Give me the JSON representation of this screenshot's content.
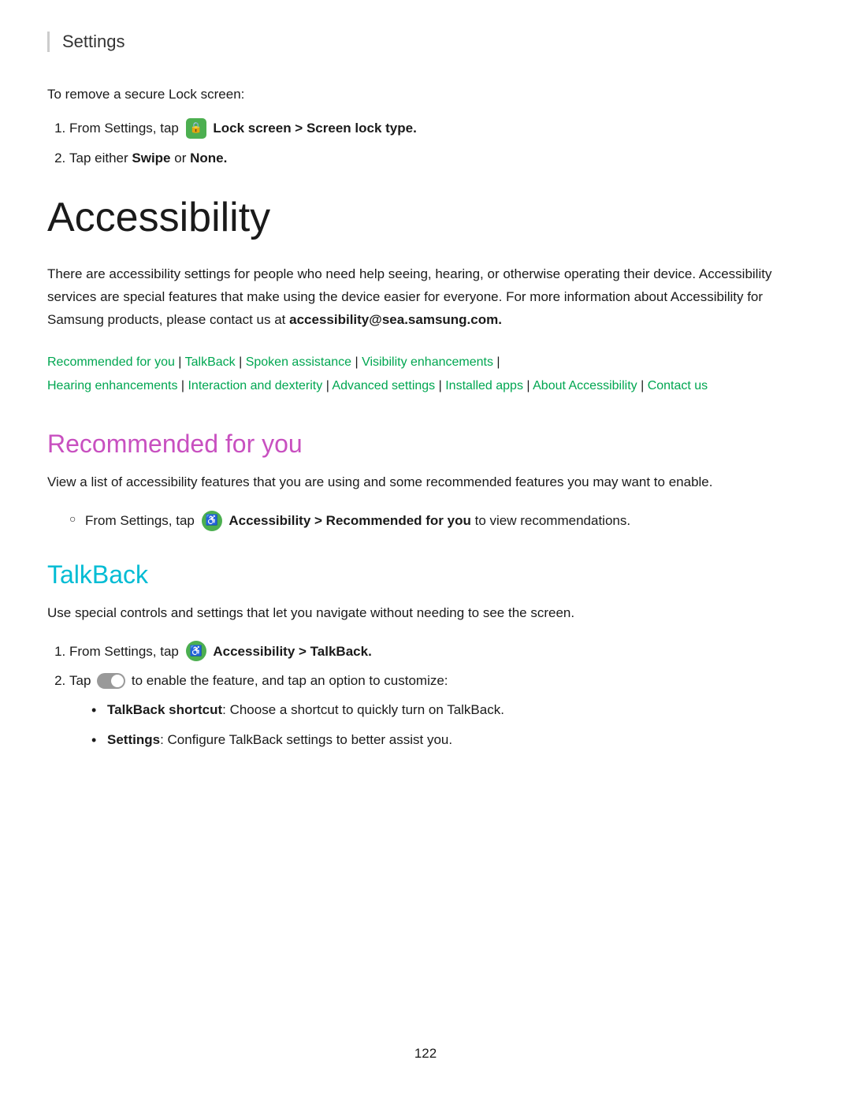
{
  "header": {
    "title": "Settings",
    "border_color": "#cccccc"
  },
  "intro": {
    "text": "To remove a secure Lock screen:",
    "steps": [
      {
        "id": 1,
        "prefix": "From Settings, tap",
        "icon": "lock-icon",
        "bold_text": "Lock screen > Screen lock type.",
        "suffix": ""
      },
      {
        "id": 2,
        "prefix": "Tap either",
        "bold_parts": [
          "Swipe",
          "None"
        ],
        "connector": "or",
        "suffix": "."
      }
    ]
  },
  "page_title": "Accessibility",
  "description": "There are accessibility settings for people who need help seeing, hearing, or otherwise operating their device. Accessibility services are special features that make using the device easier for everyone. For more information about Accessibility for Samsung products, please contact us at",
  "email": "accessibility@sea.samsung.com.",
  "nav_links": [
    {
      "label": "Recommended for you",
      "color": "#00a651"
    },
    {
      "label": "TalkBack",
      "color": "#00a651"
    },
    {
      "label": "Spoken assistance",
      "color": "#00a651"
    },
    {
      "label": "Visibility enhancements",
      "color": "#00a651"
    },
    {
      "label": "Hearing enhancements",
      "color": "#00a651"
    },
    {
      "label": "Interaction and dexterity",
      "color": "#00a651"
    },
    {
      "label": "Advanced settings",
      "color": "#00a651"
    },
    {
      "label": "Installed apps",
      "color": "#00a651"
    },
    {
      "label": "About Accessibility",
      "color": "#00a651"
    },
    {
      "label": "Contact us",
      "color": "#00a651"
    }
  ],
  "sections": [
    {
      "id": "recommended",
      "title": "Recommended for you",
      "title_color": "#c850c0",
      "description": "View a list of accessibility features that you are using and some recommended features you may want to enable.",
      "items": [
        {
          "type": "bullet",
          "prefix": "From Settings, tap",
          "icon": "accessibility-icon",
          "bold_text": "Accessibility > Recommended for you",
          "suffix": "to view recommendations."
        }
      ]
    },
    {
      "id": "talkback",
      "title": "TalkBack",
      "title_color": "#00bcd4",
      "description": "Use special controls and settings that let you navigate without needing to see the screen.",
      "numbered_items": [
        {
          "id": 1,
          "prefix": "From Settings, tap",
          "icon": "accessibility-icon",
          "bold_text": "Accessibility > TalkBack.",
          "suffix": ""
        },
        {
          "id": 2,
          "prefix": "Tap",
          "icon": "toggle-icon",
          "suffix": "to enable the feature, and tap an option to customize:"
        }
      ],
      "sub_items": [
        {
          "bold_label": "TalkBack shortcut",
          "text": ": Choose a shortcut to quickly turn on TalkBack."
        },
        {
          "bold_label": "Settings",
          "text": ": Configure TalkBack settings to better assist you."
        }
      ]
    }
  ],
  "page_number": "122"
}
